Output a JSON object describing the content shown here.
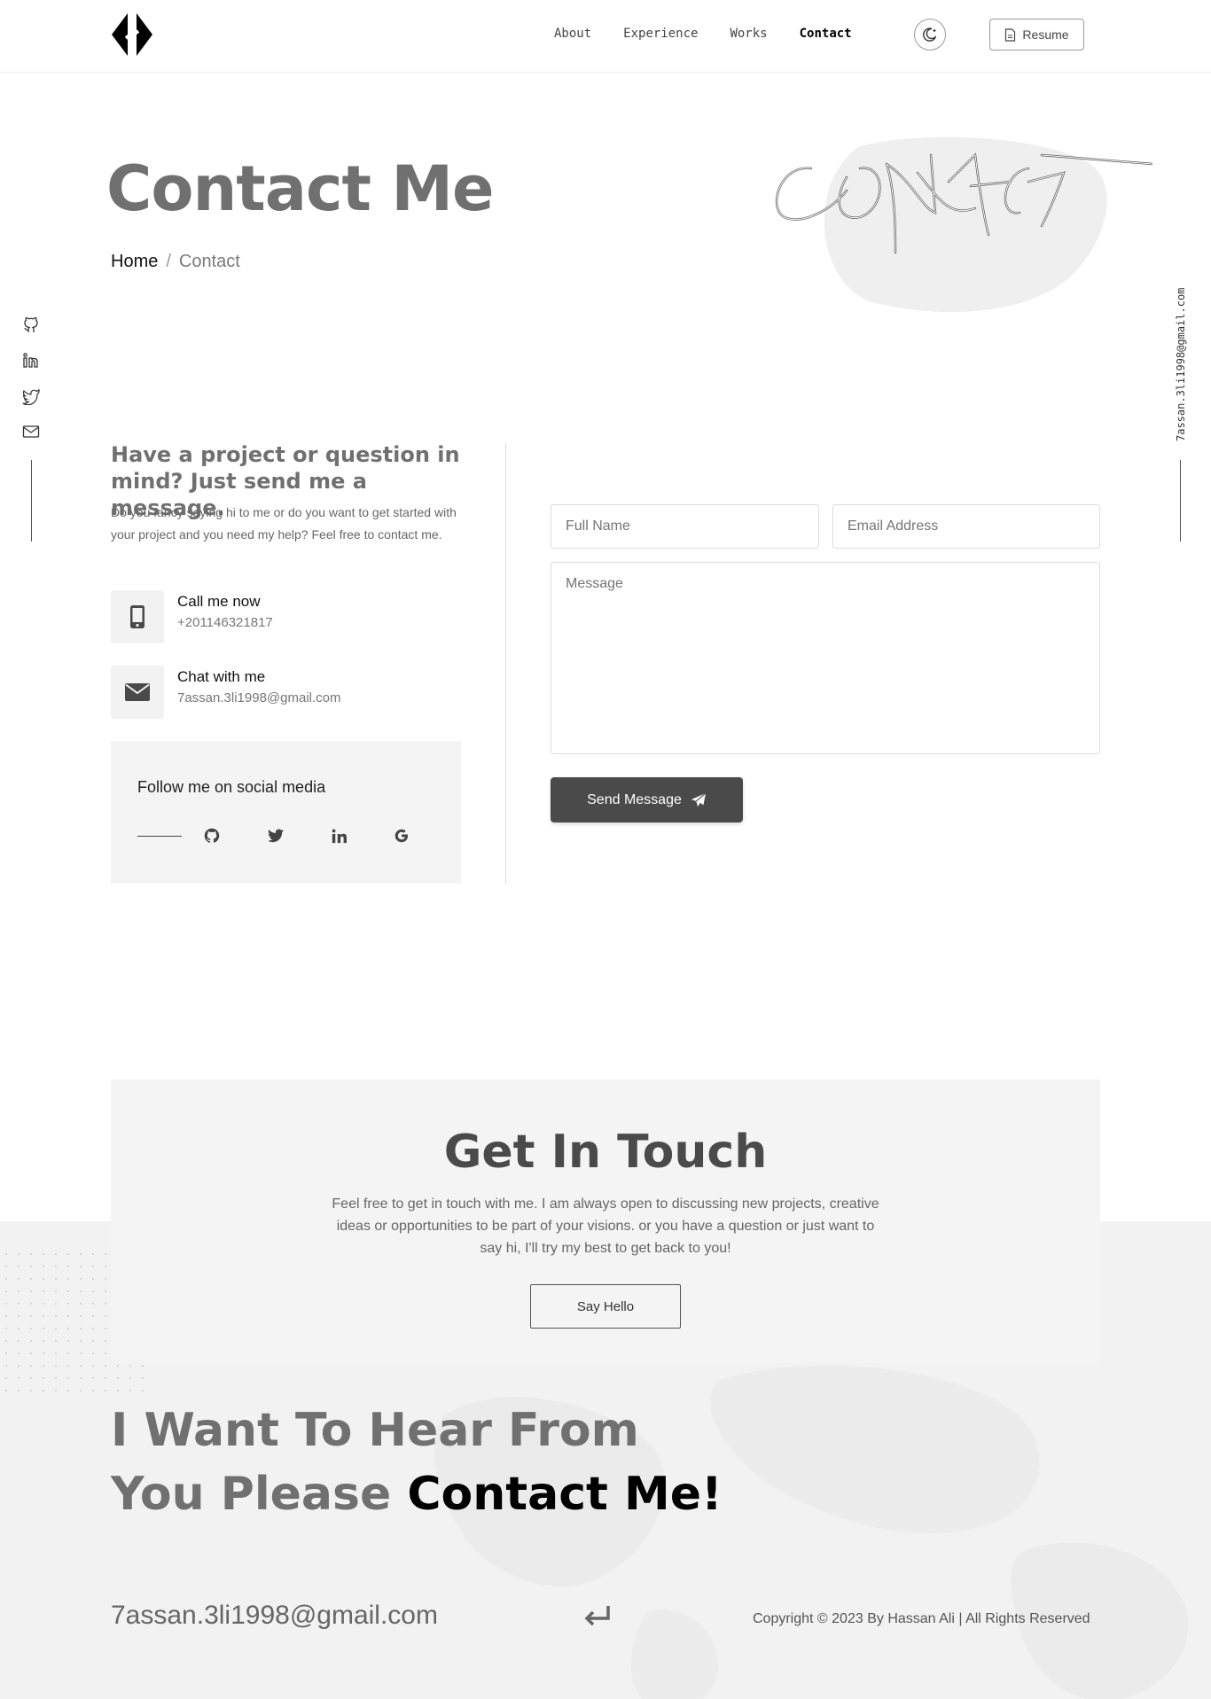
{
  "nav": {
    "items": [
      {
        "label": "About"
      },
      {
        "label": "Experience"
      },
      {
        "label": "Works"
      },
      {
        "label": "Contact"
      }
    ],
    "active": "Contact",
    "resume_label": "Resume"
  },
  "hero": {
    "title": "Contact Me",
    "breadcrumb": {
      "home": "Home",
      "separator": "/",
      "current": "Contact"
    }
  },
  "side": {
    "email": "7assan.3li1998@gmail.com",
    "icons": [
      "github-icon",
      "linkedin-icon",
      "twitter-icon",
      "mail-icon"
    ]
  },
  "contact": {
    "heading": "Have a project or question in mind? Just send me a message.",
    "description": "Do you fancy saying hi to me or do you want to get started with your project and you need my help? Feel free to contact me.",
    "call": {
      "title": "Call me now",
      "value": "+201146321817"
    },
    "chat": {
      "title": "Chat with me",
      "value": "7assan.3li1998@gmail.com"
    },
    "follow": {
      "title": "Follow me on social media",
      "icons": [
        "github-icon",
        "twitter-icon",
        "linkedin-icon",
        "google-icon"
      ]
    },
    "form": {
      "name_placeholder": "Full Name",
      "email_placeholder": "Email Address",
      "message_placeholder": "Message",
      "submit_label": "Send Message"
    }
  },
  "get_in_touch": {
    "title": "Get In Touch",
    "description": "Feel free to get in touch with me. I am always open to discussing new projects, creative ideas or opportunities to be part of your visions. or you have a question or just want to say hi, I'll try my best to get back to you!",
    "button_label": "Say Hello"
  },
  "footer": {
    "heading_line1": "I Want To Hear From",
    "heading_line2_plain": "You Please ",
    "heading_line2_strong": "Contact Me!",
    "email": "7assan.3li1998@gmail.com",
    "copyright": "Copyright © 2023 By Hassan Ali | All Rights Reserved"
  },
  "colors": {
    "accent": "#4a4a4a",
    "muted": "#707070",
    "panel": "#f4f4f4"
  }
}
